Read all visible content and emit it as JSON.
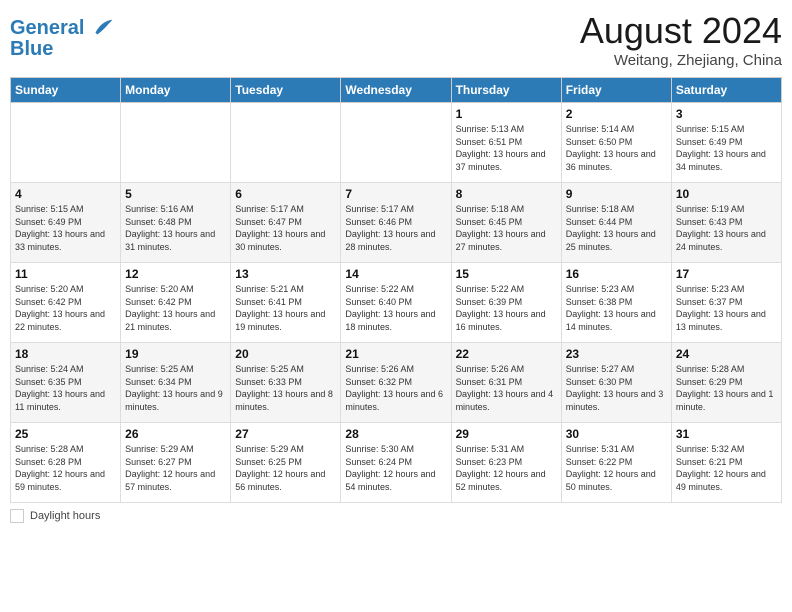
{
  "header": {
    "logo_line1": "General",
    "logo_line2": "Blue",
    "month_year": "August 2024",
    "location": "Weitang, Zhejiang, China"
  },
  "days_of_week": [
    "Sunday",
    "Monday",
    "Tuesday",
    "Wednesday",
    "Thursday",
    "Friday",
    "Saturday"
  ],
  "weeks": [
    [
      {
        "day": "",
        "info": ""
      },
      {
        "day": "",
        "info": ""
      },
      {
        "day": "",
        "info": ""
      },
      {
        "day": "",
        "info": ""
      },
      {
        "day": "1",
        "info": "Sunrise: 5:13 AM\nSunset: 6:51 PM\nDaylight: 13 hours and 37 minutes."
      },
      {
        "day": "2",
        "info": "Sunrise: 5:14 AM\nSunset: 6:50 PM\nDaylight: 13 hours and 36 minutes."
      },
      {
        "day": "3",
        "info": "Sunrise: 5:15 AM\nSunset: 6:49 PM\nDaylight: 13 hours and 34 minutes."
      }
    ],
    [
      {
        "day": "4",
        "info": "Sunrise: 5:15 AM\nSunset: 6:49 PM\nDaylight: 13 hours and 33 minutes."
      },
      {
        "day": "5",
        "info": "Sunrise: 5:16 AM\nSunset: 6:48 PM\nDaylight: 13 hours and 31 minutes."
      },
      {
        "day": "6",
        "info": "Sunrise: 5:17 AM\nSunset: 6:47 PM\nDaylight: 13 hours and 30 minutes."
      },
      {
        "day": "7",
        "info": "Sunrise: 5:17 AM\nSunset: 6:46 PM\nDaylight: 13 hours and 28 minutes."
      },
      {
        "day": "8",
        "info": "Sunrise: 5:18 AM\nSunset: 6:45 PM\nDaylight: 13 hours and 27 minutes."
      },
      {
        "day": "9",
        "info": "Sunrise: 5:18 AM\nSunset: 6:44 PM\nDaylight: 13 hours and 25 minutes."
      },
      {
        "day": "10",
        "info": "Sunrise: 5:19 AM\nSunset: 6:43 PM\nDaylight: 13 hours and 24 minutes."
      }
    ],
    [
      {
        "day": "11",
        "info": "Sunrise: 5:20 AM\nSunset: 6:42 PM\nDaylight: 13 hours and 22 minutes."
      },
      {
        "day": "12",
        "info": "Sunrise: 5:20 AM\nSunset: 6:42 PM\nDaylight: 13 hours and 21 minutes."
      },
      {
        "day": "13",
        "info": "Sunrise: 5:21 AM\nSunset: 6:41 PM\nDaylight: 13 hours and 19 minutes."
      },
      {
        "day": "14",
        "info": "Sunrise: 5:22 AM\nSunset: 6:40 PM\nDaylight: 13 hours and 18 minutes."
      },
      {
        "day": "15",
        "info": "Sunrise: 5:22 AM\nSunset: 6:39 PM\nDaylight: 13 hours and 16 minutes."
      },
      {
        "day": "16",
        "info": "Sunrise: 5:23 AM\nSunset: 6:38 PM\nDaylight: 13 hours and 14 minutes."
      },
      {
        "day": "17",
        "info": "Sunrise: 5:23 AM\nSunset: 6:37 PM\nDaylight: 13 hours and 13 minutes."
      }
    ],
    [
      {
        "day": "18",
        "info": "Sunrise: 5:24 AM\nSunset: 6:35 PM\nDaylight: 13 hours and 11 minutes."
      },
      {
        "day": "19",
        "info": "Sunrise: 5:25 AM\nSunset: 6:34 PM\nDaylight: 13 hours and 9 minutes."
      },
      {
        "day": "20",
        "info": "Sunrise: 5:25 AM\nSunset: 6:33 PM\nDaylight: 13 hours and 8 minutes."
      },
      {
        "day": "21",
        "info": "Sunrise: 5:26 AM\nSunset: 6:32 PM\nDaylight: 13 hours and 6 minutes."
      },
      {
        "day": "22",
        "info": "Sunrise: 5:26 AM\nSunset: 6:31 PM\nDaylight: 13 hours and 4 minutes."
      },
      {
        "day": "23",
        "info": "Sunrise: 5:27 AM\nSunset: 6:30 PM\nDaylight: 13 hours and 3 minutes."
      },
      {
        "day": "24",
        "info": "Sunrise: 5:28 AM\nSunset: 6:29 PM\nDaylight: 13 hours and 1 minute."
      }
    ],
    [
      {
        "day": "25",
        "info": "Sunrise: 5:28 AM\nSunset: 6:28 PM\nDaylight: 12 hours and 59 minutes."
      },
      {
        "day": "26",
        "info": "Sunrise: 5:29 AM\nSunset: 6:27 PM\nDaylight: 12 hours and 57 minutes."
      },
      {
        "day": "27",
        "info": "Sunrise: 5:29 AM\nSunset: 6:25 PM\nDaylight: 12 hours and 56 minutes."
      },
      {
        "day": "28",
        "info": "Sunrise: 5:30 AM\nSunset: 6:24 PM\nDaylight: 12 hours and 54 minutes."
      },
      {
        "day": "29",
        "info": "Sunrise: 5:31 AM\nSunset: 6:23 PM\nDaylight: 12 hours and 52 minutes."
      },
      {
        "day": "30",
        "info": "Sunrise: 5:31 AM\nSunset: 6:22 PM\nDaylight: 12 hours and 50 minutes."
      },
      {
        "day": "31",
        "info": "Sunrise: 5:32 AM\nSunset: 6:21 PM\nDaylight: 12 hours and 49 minutes."
      }
    ]
  ],
  "footer": {
    "daylight_label": "Daylight hours"
  }
}
